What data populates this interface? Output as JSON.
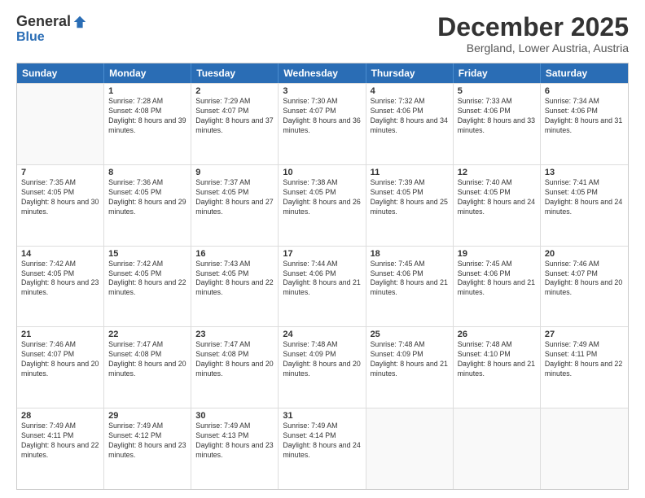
{
  "header": {
    "logo_general": "General",
    "logo_blue": "Blue",
    "title": "December 2025",
    "subtitle": "Bergland, Lower Austria, Austria"
  },
  "days_of_week": [
    "Sunday",
    "Monday",
    "Tuesday",
    "Wednesday",
    "Thursday",
    "Friday",
    "Saturday"
  ],
  "weeks": [
    [
      {
        "day": "",
        "empty": true
      },
      {
        "day": "1",
        "sunrise": "Sunrise: 7:28 AM",
        "sunset": "Sunset: 4:08 PM",
        "daylight": "Daylight: 8 hours and 39 minutes."
      },
      {
        "day": "2",
        "sunrise": "Sunrise: 7:29 AM",
        "sunset": "Sunset: 4:07 PM",
        "daylight": "Daylight: 8 hours and 37 minutes."
      },
      {
        "day": "3",
        "sunrise": "Sunrise: 7:30 AM",
        "sunset": "Sunset: 4:07 PM",
        "daylight": "Daylight: 8 hours and 36 minutes."
      },
      {
        "day": "4",
        "sunrise": "Sunrise: 7:32 AM",
        "sunset": "Sunset: 4:06 PM",
        "daylight": "Daylight: 8 hours and 34 minutes."
      },
      {
        "day": "5",
        "sunrise": "Sunrise: 7:33 AM",
        "sunset": "Sunset: 4:06 PM",
        "daylight": "Daylight: 8 hours and 33 minutes."
      },
      {
        "day": "6",
        "sunrise": "Sunrise: 7:34 AM",
        "sunset": "Sunset: 4:06 PM",
        "daylight": "Daylight: 8 hours and 31 minutes."
      }
    ],
    [
      {
        "day": "7",
        "sunrise": "Sunrise: 7:35 AM",
        "sunset": "Sunset: 4:05 PM",
        "daylight": "Daylight: 8 hours and 30 minutes."
      },
      {
        "day": "8",
        "sunrise": "Sunrise: 7:36 AM",
        "sunset": "Sunset: 4:05 PM",
        "daylight": "Daylight: 8 hours and 29 minutes."
      },
      {
        "day": "9",
        "sunrise": "Sunrise: 7:37 AM",
        "sunset": "Sunset: 4:05 PM",
        "daylight": "Daylight: 8 hours and 27 minutes."
      },
      {
        "day": "10",
        "sunrise": "Sunrise: 7:38 AM",
        "sunset": "Sunset: 4:05 PM",
        "daylight": "Daylight: 8 hours and 26 minutes."
      },
      {
        "day": "11",
        "sunrise": "Sunrise: 7:39 AM",
        "sunset": "Sunset: 4:05 PM",
        "daylight": "Daylight: 8 hours and 25 minutes."
      },
      {
        "day": "12",
        "sunrise": "Sunrise: 7:40 AM",
        "sunset": "Sunset: 4:05 PM",
        "daylight": "Daylight: 8 hours and 24 minutes."
      },
      {
        "day": "13",
        "sunrise": "Sunrise: 7:41 AM",
        "sunset": "Sunset: 4:05 PM",
        "daylight": "Daylight: 8 hours and 24 minutes."
      }
    ],
    [
      {
        "day": "14",
        "sunrise": "Sunrise: 7:42 AM",
        "sunset": "Sunset: 4:05 PM",
        "daylight": "Daylight: 8 hours and 23 minutes."
      },
      {
        "day": "15",
        "sunrise": "Sunrise: 7:42 AM",
        "sunset": "Sunset: 4:05 PM",
        "daylight": "Daylight: 8 hours and 22 minutes."
      },
      {
        "day": "16",
        "sunrise": "Sunrise: 7:43 AM",
        "sunset": "Sunset: 4:05 PM",
        "daylight": "Daylight: 8 hours and 22 minutes."
      },
      {
        "day": "17",
        "sunrise": "Sunrise: 7:44 AM",
        "sunset": "Sunset: 4:06 PM",
        "daylight": "Daylight: 8 hours and 21 minutes."
      },
      {
        "day": "18",
        "sunrise": "Sunrise: 7:45 AM",
        "sunset": "Sunset: 4:06 PM",
        "daylight": "Daylight: 8 hours and 21 minutes."
      },
      {
        "day": "19",
        "sunrise": "Sunrise: 7:45 AM",
        "sunset": "Sunset: 4:06 PM",
        "daylight": "Daylight: 8 hours and 21 minutes."
      },
      {
        "day": "20",
        "sunrise": "Sunrise: 7:46 AM",
        "sunset": "Sunset: 4:07 PM",
        "daylight": "Daylight: 8 hours and 20 minutes."
      }
    ],
    [
      {
        "day": "21",
        "sunrise": "Sunrise: 7:46 AM",
        "sunset": "Sunset: 4:07 PM",
        "daylight": "Daylight: 8 hours and 20 minutes."
      },
      {
        "day": "22",
        "sunrise": "Sunrise: 7:47 AM",
        "sunset": "Sunset: 4:08 PM",
        "daylight": "Daylight: 8 hours and 20 minutes."
      },
      {
        "day": "23",
        "sunrise": "Sunrise: 7:47 AM",
        "sunset": "Sunset: 4:08 PM",
        "daylight": "Daylight: 8 hours and 20 minutes."
      },
      {
        "day": "24",
        "sunrise": "Sunrise: 7:48 AM",
        "sunset": "Sunset: 4:09 PM",
        "daylight": "Daylight: 8 hours and 20 minutes."
      },
      {
        "day": "25",
        "sunrise": "Sunrise: 7:48 AM",
        "sunset": "Sunset: 4:09 PM",
        "daylight": "Daylight: 8 hours and 21 minutes."
      },
      {
        "day": "26",
        "sunrise": "Sunrise: 7:48 AM",
        "sunset": "Sunset: 4:10 PM",
        "daylight": "Daylight: 8 hours and 21 minutes."
      },
      {
        "day": "27",
        "sunrise": "Sunrise: 7:49 AM",
        "sunset": "Sunset: 4:11 PM",
        "daylight": "Daylight: 8 hours and 22 minutes."
      }
    ],
    [
      {
        "day": "28",
        "sunrise": "Sunrise: 7:49 AM",
        "sunset": "Sunset: 4:11 PM",
        "daylight": "Daylight: 8 hours and 22 minutes."
      },
      {
        "day": "29",
        "sunrise": "Sunrise: 7:49 AM",
        "sunset": "Sunset: 4:12 PM",
        "daylight": "Daylight: 8 hours and 23 minutes."
      },
      {
        "day": "30",
        "sunrise": "Sunrise: 7:49 AM",
        "sunset": "Sunset: 4:13 PM",
        "daylight": "Daylight: 8 hours and 23 minutes."
      },
      {
        "day": "31",
        "sunrise": "Sunrise: 7:49 AM",
        "sunset": "Sunset: 4:14 PM",
        "daylight": "Daylight: 8 hours and 24 minutes."
      },
      {
        "day": "",
        "empty": true
      },
      {
        "day": "",
        "empty": true
      },
      {
        "day": "",
        "empty": true
      }
    ]
  ]
}
